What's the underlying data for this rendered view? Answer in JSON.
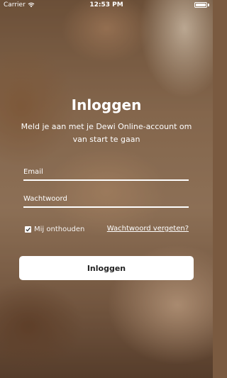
{
  "status_bar": {
    "carrier": "Carrier",
    "time": "12:53 PM"
  },
  "login": {
    "title": "Inloggen",
    "subtitle": "Meld je aan met je Dewi Online-account om van start te gaan",
    "email_placeholder": "Email",
    "password_placeholder": "Wachtwoord",
    "remember_label": "Mij onthouden",
    "remember_checked": true,
    "forgot_link": "Wachtwoord vergeten?",
    "submit_label": "Inloggen"
  },
  "colors": {
    "text": "#ffffff",
    "button_background": "#ffffff",
    "button_text": "#222222"
  }
}
